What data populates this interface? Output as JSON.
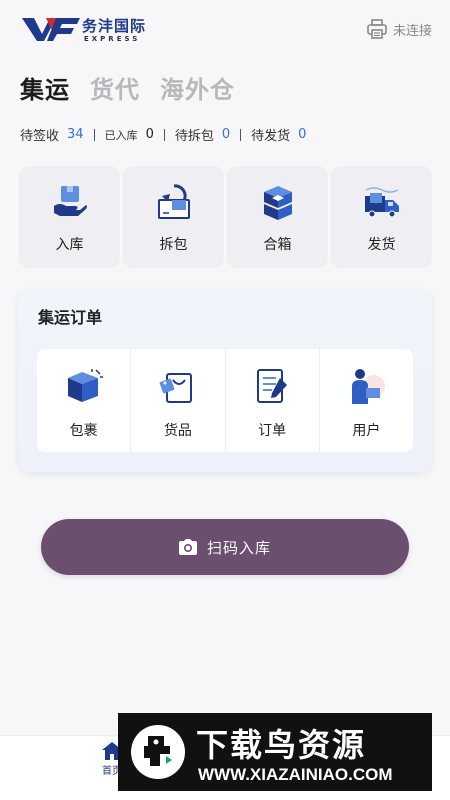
{
  "header": {
    "logo_cn": "务沣国际",
    "logo_en": "EXPRESS",
    "printer_status": "未连接",
    "printer_icon": "printer-icon"
  },
  "tabs": [
    {
      "label": "集运",
      "active": true
    },
    {
      "label": "货代",
      "active": false
    },
    {
      "label": "海外仓",
      "active": false
    }
  ],
  "stats": [
    {
      "label": "待签收",
      "value": "34"
    },
    {
      "label": "已入库",
      "value": "0"
    },
    {
      "label": "待拆包",
      "value": "0"
    },
    {
      "label": "待发货",
      "value": "0"
    }
  ],
  "actions": [
    {
      "label": "入库",
      "icon": "package-in-hand-icon"
    },
    {
      "label": "拆包",
      "icon": "unpack-box-icon"
    },
    {
      "label": "合箱",
      "icon": "combine-box-icon"
    },
    {
      "label": "发货",
      "icon": "delivery-truck-icon"
    }
  ],
  "order_section": {
    "title": "集运订单",
    "items": [
      {
        "label": "包裹",
        "icon": "parcel-icon"
      },
      {
        "label": "货品",
        "icon": "goods-bag-icon"
      },
      {
        "label": "订单",
        "icon": "order-form-icon"
      },
      {
        "label": "用户",
        "icon": "user-icon"
      }
    ]
  },
  "scan_button": {
    "label": "扫码入库",
    "icon": "camera-icon"
  },
  "bottom_nav": {
    "home_label": "首页",
    "home_icon": "home-icon"
  },
  "watermark": {
    "cn": "下载鸟资源",
    "en": "WWW.XIAZAINIAO.COM"
  },
  "colors": {
    "accent_blue": "#2f6fd6",
    "brand_navy": "#1f3a8a",
    "scan_button": "#6b4f6e"
  }
}
